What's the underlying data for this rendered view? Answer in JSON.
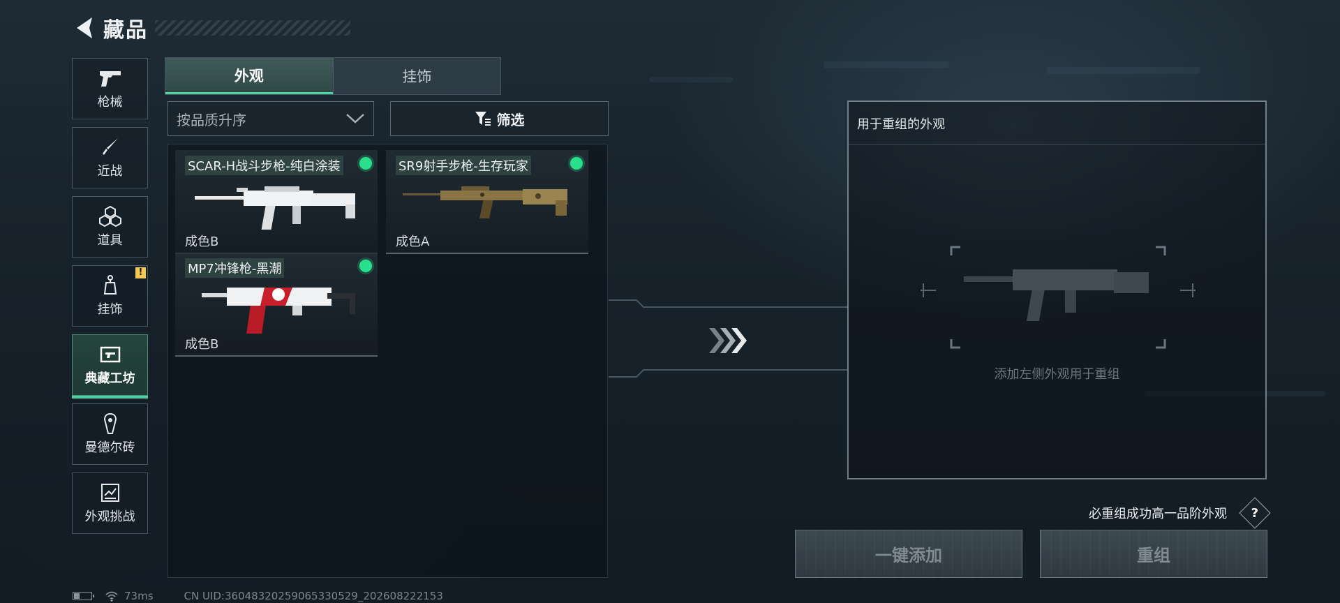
{
  "header": {
    "title": "藏品",
    "back_icon": "back-arrow-icon"
  },
  "sidebar": {
    "items": [
      {
        "label": "枪械",
        "icon": "pistol-icon",
        "active": false
      },
      {
        "label": "近战",
        "icon": "knife-icon",
        "active": false
      },
      {
        "label": "道具",
        "icon": "items-cubes-icon",
        "active": false
      },
      {
        "label": "挂饰",
        "icon": "charm-icon",
        "active": false,
        "badge": "!"
      },
      {
        "label": "典藏工坊",
        "icon": "workshop-icon",
        "active": true
      },
      {
        "label": "曼德尔砖",
        "icon": "brick-icon",
        "active": false
      },
      {
        "label": "外观挑战",
        "icon": "challenge-icon",
        "active": false
      }
    ]
  },
  "tabs": [
    {
      "label": "外观",
      "active": true
    },
    {
      "label": "挂饰",
      "active": false
    }
  ],
  "sort": {
    "value": "按品质升序"
  },
  "filter": {
    "label": "筛选"
  },
  "items": [
    {
      "name": "SCAR-H战斗步枪-纯白涂装",
      "grade": "成色B",
      "status_color": "#28e08c"
    },
    {
      "name": "SR9射手步枪-生存玩家",
      "grade": "成色A",
      "status_color": "#28e08c"
    },
    {
      "name": "MP7冲锋枪-黑潮",
      "grade": "成色B",
      "status_color": "#28e08c"
    }
  ],
  "reassemble": {
    "title": "用于重组的外观",
    "empty_hint": "添加左侧外观用于重组"
  },
  "footer": {
    "note": "必重组成功高一品阶外观",
    "help_label": "?",
    "add_button": "一键添加",
    "reassemble_button": "重组"
  },
  "status_bar": {
    "ping": "73ms",
    "uid": "CN UID:3604832025906533052​9_202608222153"
  },
  "colors": {
    "accent": "#4fd1a3",
    "status_green": "#28e08c",
    "warning": "#f2c94c"
  }
}
